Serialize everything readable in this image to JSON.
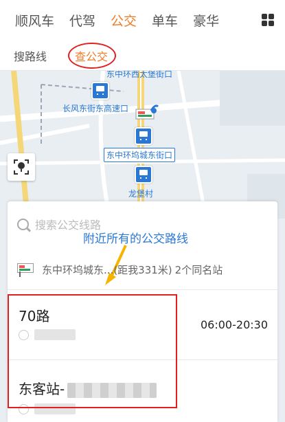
{
  "top_tabs": [
    "顺风车",
    "代驾",
    "公交",
    "单车",
    "豪华"
  ],
  "active_top_tab": "公交",
  "sub_tabs": [
    "搜路线",
    "查公交"
  ],
  "active_sub_tab": "查公交",
  "map": {
    "stops": [
      {
        "label": "东中环西太堡街口"
      },
      {
        "label": "长风东街东高速口"
      },
      {
        "label": "东中环坞城东街口"
      },
      {
        "label": "龙堡村"
      }
    ]
  },
  "search": {
    "placeholder": "搜索公交线路"
  },
  "annotation": "附近所有的公交路线",
  "station": {
    "name": "东中环坞城东...",
    "distance": "(距我331米)",
    "same_name": "2个同名站"
  },
  "routes": [
    {
      "name": "70路",
      "time": "06:00-20:30"
    },
    {
      "name": "东客站-"
    }
  ],
  "colors": {
    "accent": "#f07c26",
    "link": "#2a78d6",
    "highlight": "#e02020"
  }
}
